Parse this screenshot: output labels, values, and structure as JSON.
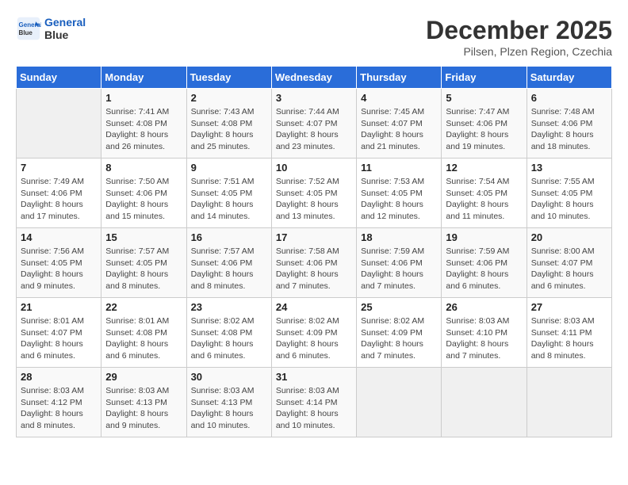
{
  "header": {
    "logo_line1": "General",
    "logo_line2": "Blue",
    "month": "December 2025",
    "location": "Pilsen, Plzen Region, Czechia"
  },
  "weekdays": [
    "Sunday",
    "Monday",
    "Tuesday",
    "Wednesday",
    "Thursday",
    "Friday",
    "Saturday"
  ],
  "weeks": [
    [
      {
        "day": "",
        "info": ""
      },
      {
        "day": "1",
        "info": "Sunrise: 7:41 AM\nSunset: 4:08 PM\nDaylight: 8 hours\nand 26 minutes."
      },
      {
        "day": "2",
        "info": "Sunrise: 7:43 AM\nSunset: 4:08 PM\nDaylight: 8 hours\nand 25 minutes."
      },
      {
        "day": "3",
        "info": "Sunrise: 7:44 AM\nSunset: 4:07 PM\nDaylight: 8 hours\nand 23 minutes."
      },
      {
        "day": "4",
        "info": "Sunrise: 7:45 AM\nSunset: 4:07 PM\nDaylight: 8 hours\nand 21 minutes."
      },
      {
        "day": "5",
        "info": "Sunrise: 7:47 AM\nSunset: 4:06 PM\nDaylight: 8 hours\nand 19 minutes."
      },
      {
        "day": "6",
        "info": "Sunrise: 7:48 AM\nSunset: 4:06 PM\nDaylight: 8 hours\nand 18 minutes."
      }
    ],
    [
      {
        "day": "7",
        "info": "Sunrise: 7:49 AM\nSunset: 4:06 PM\nDaylight: 8 hours\nand 17 minutes."
      },
      {
        "day": "8",
        "info": "Sunrise: 7:50 AM\nSunset: 4:06 PM\nDaylight: 8 hours\nand 15 minutes."
      },
      {
        "day": "9",
        "info": "Sunrise: 7:51 AM\nSunset: 4:05 PM\nDaylight: 8 hours\nand 14 minutes."
      },
      {
        "day": "10",
        "info": "Sunrise: 7:52 AM\nSunset: 4:05 PM\nDaylight: 8 hours\nand 13 minutes."
      },
      {
        "day": "11",
        "info": "Sunrise: 7:53 AM\nSunset: 4:05 PM\nDaylight: 8 hours\nand 12 minutes."
      },
      {
        "day": "12",
        "info": "Sunrise: 7:54 AM\nSunset: 4:05 PM\nDaylight: 8 hours\nand 11 minutes."
      },
      {
        "day": "13",
        "info": "Sunrise: 7:55 AM\nSunset: 4:05 PM\nDaylight: 8 hours\nand 10 minutes."
      }
    ],
    [
      {
        "day": "14",
        "info": "Sunrise: 7:56 AM\nSunset: 4:05 PM\nDaylight: 8 hours\nand 9 minutes."
      },
      {
        "day": "15",
        "info": "Sunrise: 7:57 AM\nSunset: 4:05 PM\nDaylight: 8 hours\nand 8 minutes."
      },
      {
        "day": "16",
        "info": "Sunrise: 7:57 AM\nSunset: 4:06 PM\nDaylight: 8 hours\nand 8 minutes."
      },
      {
        "day": "17",
        "info": "Sunrise: 7:58 AM\nSunset: 4:06 PM\nDaylight: 8 hours\nand 7 minutes."
      },
      {
        "day": "18",
        "info": "Sunrise: 7:59 AM\nSunset: 4:06 PM\nDaylight: 8 hours\nand 7 minutes."
      },
      {
        "day": "19",
        "info": "Sunrise: 7:59 AM\nSunset: 4:06 PM\nDaylight: 8 hours\nand 6 minutes."
      },
      {
        "day": "20",
        "info": "Sunrise: 8:00 AM\nSunset: 4:07 PM\nDaylight: 8 hours\nand 6 minutes."
      }
    ],
    [
      {
        "day": "21",
        "info": "Sunrise: 8:01 AM\nSunset: 4:07 PM\nDaylight: 8 hours\nand 6 minutes."
      },
      {
        "day": "22",
        "info": "Sunrise: 8:01 AM\nSunset: 4:08 PM\nDaylight: 8 hours\nand 6 minutes."
      },
      {
        "day": "23",
        "info": "Sunrise: 8:02 AM\nSunset: 4:08 PM\nDaylight: 8 hours\nand 6 minutes."
      },
      {
        "day": "24",
        "info": "Sunrise: 8:02 AM\nSunset: 4:09 PM\nDaylight: 8 hours\nand 6 minutes."
      },
      {
        "day": "25",
        "info": "Sunrise: 8:02 AM\nSunset: 4:09 PM\nDaylight: 8 hours\nand 7 minutes."
      },
      {
        "day": "26",
        "info": "Sunrise: 8:03 AM\nSunset: 4:10 PM\nDaylight: 8 hours\nand 7 minutes."
      },
      {
        "day": "27",
        "info": "Sunrise: 8:03 AM\nSunset: 4:11 PM\nDaylight: 8 hours\nand 8 minutes."
      }
    ],
    [
      {
        "day": "28",
        "info": "Sunrise: 8:03 AM\nSunset: 4:12 PM\nDaylight: 8 hours\nand 8 minutes."
      },
      {
        "day": "29",
        "info": "Sunrise: 8:03 AM\nSunset: 4:13 PM\nDaylight: 8 hours\nand 9 minutes."
      },
      {
        "day": "30",
        "info": "Sunrise: 8:03 AM\nSunset: 4:13 PM\nDaylight: 8 hours\nand 10 minutes."
      },
      {
        "day": "31",
        "info": "Sunrise: 8:03 AM\nSunset: 4:14 PM\nDaylight: 8 hours\nand 10 minutes."
      },
      {
        "day": "",
        "info": ""
      },
      {
        "day": "",
        "info": ""
      },
      {
        "day": "",
        "info": ""
      }
    ]
  ]
}
